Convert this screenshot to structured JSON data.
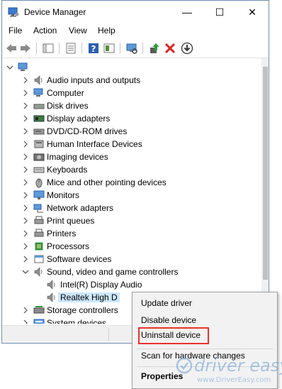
{
  "window": {
    "title": "Device Manager",
    "controls": {
      "minimize": "—",
      "maximize": "☐",
      "close": "✕"
    }
  },
  "menu": [
    "File",
    "Action",
    "View",
    "Help"
  ],
  "toolbar": {
    "buttons": [
      "back-arrow-icon",
      "forward-arrow-icon",
      "show-hide-icon",
      "properties-icon",
      "help-icon",
      "view-icon",
      "scan-hardware-icon",
      "update-driver-icon",
      "uninstall-x-icon",
      "disable-download-icon"
    ]
  },
  "tree": {
    "root": "",
    "items": [
      {
        "label": "Audio inputs and outputs",
        "icon": "speaker-icon"
      },
      {
        "label": "Computer",
        "icon": "computer-icon"
      },
      {
        "label": "Disk drives",
        "icon": "disk-drive-icon"
      },
      {
        "label": "Display adapters",
        "icon": "display-adapter-icon"
      },
      {
        "label": "DVD/CD-ROM drives",
        "icon": "dvd-drive-icon"
      },
      {
        "label": "Human Interface Devices",
        "icon": "hid-icon"
      },
      {
        "label": "Imaging devices",
        "icon": "camera-icon"
      },
      {
        "label": "Keyboards",
        "icon": "keyboard-icon"
      },
      {
        "label": "Mice and other pointing devices",
        "icon": "mouse-icon"
      },
      {
        "label": "Monitors",
        "icon": "monitor-icon"
      },
      {
        "label": "Network adapters",
        "icon": "network-icon"
      },
      {
        "label": "Print queues",
        "icon": "printer-icon"
      },
      {
        "label": "Printers",
        "icon": "printer-icon"
      },
      {
        "label": "Processors",
        "icon": "processor-icon"
      },
      {
        "label": "Software devices",
        "icon": "software-device-icon"
      },
      {
        "label": "Sound, video and game controllers",
        "icon": "speaker-icon"
      }
    ],
    "sound_children": [
      {
        "label": "Intel(R) Display Audio",
        "icon": "speaker-icon"
      },
      {
        "label": "Realtek High D",
        "icon": "speaker-icon"
      }
    ],
    "after_items": [
      {
        "label": "Storage controllers",
        "icon": "storage-icon"
      },
      {
        "label": "System devices",
        "icon": "system-icon"
      }
    ]
  },
  "context_menu": {
    "items": [
      "Update driver",
      "Disable device",
      "Uninstall device",
      "Scan for hardware changes",
      "Properties"
    ],
    "highlighted": "Uninstall device",
    "highlight_color": "#e8322f"
  },
  "watermark": {
    "brand": "driver easy",
    "url": "www.DriverEasy.com"
  },
  "colors": {
    "selection": "#cce8ff",
    "border": "#6e8fb5",
    "accent_red": "#e8322f",
    "accent_green": "#2e9e3e"
  }
}
